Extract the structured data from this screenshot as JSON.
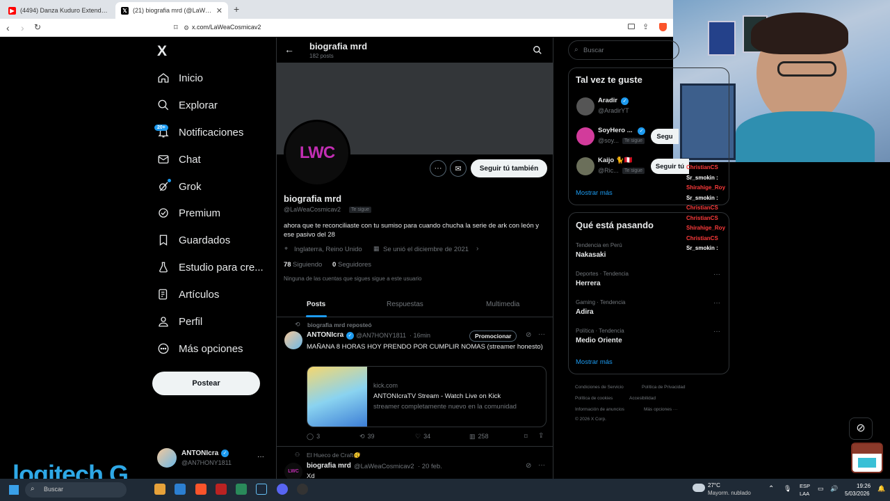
{
  "browser": {
    "tabs": [
      {
        "label": "(4494) Danza Kuduro Extended D",
        "favicon_color": "#ff0000"
      },
      {
        "label": "(21) biografia mrd (@LaWeaCo",
        "favicon_color": "#000000"
      }
    ],
    "new_tab": "+",
    "url": "x.com/LaWeaCosmicav2"
  },
  "nav": {
    "logo": "X",
    "items": [
      {
        "label": "Inicio",
        "icon": "home-icon"
      },
      {
        "label": "Explorar",
        "icon": "search-icon"
      },
      {
        "label": "Notificaciones",
        "icon": "bell-icon",
        "badge": "20+"
      },
      {
        "label": "Chat",
        "icon": "mail-icon"
      },
      {
        "label": "Grok",
        "icon": "grok-icon"
      },
      {
        "label": "Premium",
        "icon": "verified-icon"
      },
      {
        "label": "Guardados",
        "icon": "bookmark-icon"
      },
      {
        "label": "Estudio para cre...",
        "icon": "studio-icon"
      },
      {
        "label": "Artículos",
        "icon": "article-icon"
      },
      {
        "label": "Perfil",
        "icon": "person-icon"
      },
      {
        "label": "Más opciones",
        "icon": "more-circle-icon"
      }
    ],
    "post_button": "Postear",
    "account": {
      "name": "ANTONIcra",
      "handle": "@AN7HONY1811",
      "more": "···"
    }
  },
  "profile": {
    "header_title": "biografia mrd",
    "header_posts": "182 posts",
    "avatar_text": "LWC",
    "follow_button": "Seguir tú también",
    "name": "biografia mrd",
    "handle": "@LaWeaCosmicav2",
    "follows_you": "Te sigue",
    "bio": "ahora que te reconciliaste con tu sumiso para cuando chucha la serie de ark con león y ese pasivo del 28",
    "location": "Inglaterra, Reino Unido",
    "joined": "Se unió el diciembre de 2021",
    "following_count": "78",
    "following_label": "Siguiendo",
    "followers_count": "0",
    "followers_label": "Seguidores",
    "no_mutual": "Ninguna de las cuentas que sigues sigue a este usuario",
    "tabs": [
      "Posts",
      "Respuestas",
      "Multimedia"
    ]
  },
  "feed": [
    {
      "repost_label": "biografia mrd reposteó",
      "author": "ANTONIcra",
      "handle": "@AN7HONY1811",
      "time": "· 16min",
      "promote": "Promocionar",
      "text": "MAÑANA 8 HORAS HOY PRENDO POR CUMPLIR NOMAS (streamer honesto)",
      "card": {
        "domain": "kick.com",
        "title": "ANTONIcraTV Stream - Watch Live on Kick",
        "desc": "streamer completamente nuevo en la comunidad"
      },
      "stats": {
        "replies": "3",
        "reposts": "39",
        "likes": "34",
        "views": "258"
      }
    },
    {
      "community": "El Hueco de Craft🫨",
      "author": "biografia mrd",
      "handle": "@LaWeaCosmicav2",
      "time": "· 20 feb.",
      "text": "Xd"
    }
  ],
  "right": {
    "search_placeholder": "Buscar",
    "suggest_title": "Tal vez te guste",
    "suggestions": [
      {
        "name": "Aradir",
        "handle": "@AradirYT",
        "tag": "",
        "button": ""
      },
      {
        "name": "SoyHero ...",
        "handle": "@soy...",
        "tag": "Te sigue",
        "button": "Segu"
      },
      {
        "name": "Kaijo 🐈🇵🇪",
        "handle": "@Ric...",
        "tag": "Te sigue",
        "button": "Seguir tú"
      }
    ],
    "show_more": "Mostrar más",
    "trends_title": "Qué está pasando",
    "trends": [
      {
        "category": "Tendencia en Perú",
        "name": "Nakasaki"
      },
      {
        "category": "Deportes · Tendencia",
        "name": "Herrera"
      },
      {
        "category": "Gaming · Tendencia",
        "name": "Adira"
      },
      {
        "category": "Política · Tendencia",
        "name": "Medio Oriente"
      }
    ],
    "trends_more": "Mostrar más",
    "footer": [
      "Condiciones de Servicio",
      "Política de Privacidad",
      "Política de cookies",
      "Accesibilidad",
      "Información de anuncios",
      "Más opciones ···",
      "© 2026 X Corp."
    ]
  },
  "chat_overlay": [
    {
      "user": "ChristianCS",
      "color": "#ff3b3b"
    },
    {
      "user": "Sr_smokin :",
      "color": "#ffffff"
    },
    {
      "user": "Shirahige_Roy",
      "color": "#ff3b3b"
    },
    {
      "user": "Sr_smokin :",
      "color": "#ffffff"
    },
    {
      "user": "ChristianCS",
      "color": "#ff3b3b"
    },
    {
      "user": "ChristianCS",
      "color": "#ff3b3b"
    },
    {
      "user": "Shirahige_Roy",
      "color": "#ff3b3b"
    },
    {
      "user": "ChristianCS",
      "color": "#ff3b3b"
    },
    {
      "user": "Sr_smokin :",
      "color": "#ffffff"
    }
  ],
  "overlay_logo": "logitech G",
  "taskbar": {
    "search": "Buscar",
    "weather_temp": "27°C",
    "weather_desc": "Mayorm. nublado",
    "lang": "ESP",
    "lang2": "LAA",
    "time": "19:26",
    "date": "5/03/2026"
  },
  "colors": {
    "verified": "#1d9bf0",
    "accent": "#1d9bf0",
    "background": "#000000"
  }
}
